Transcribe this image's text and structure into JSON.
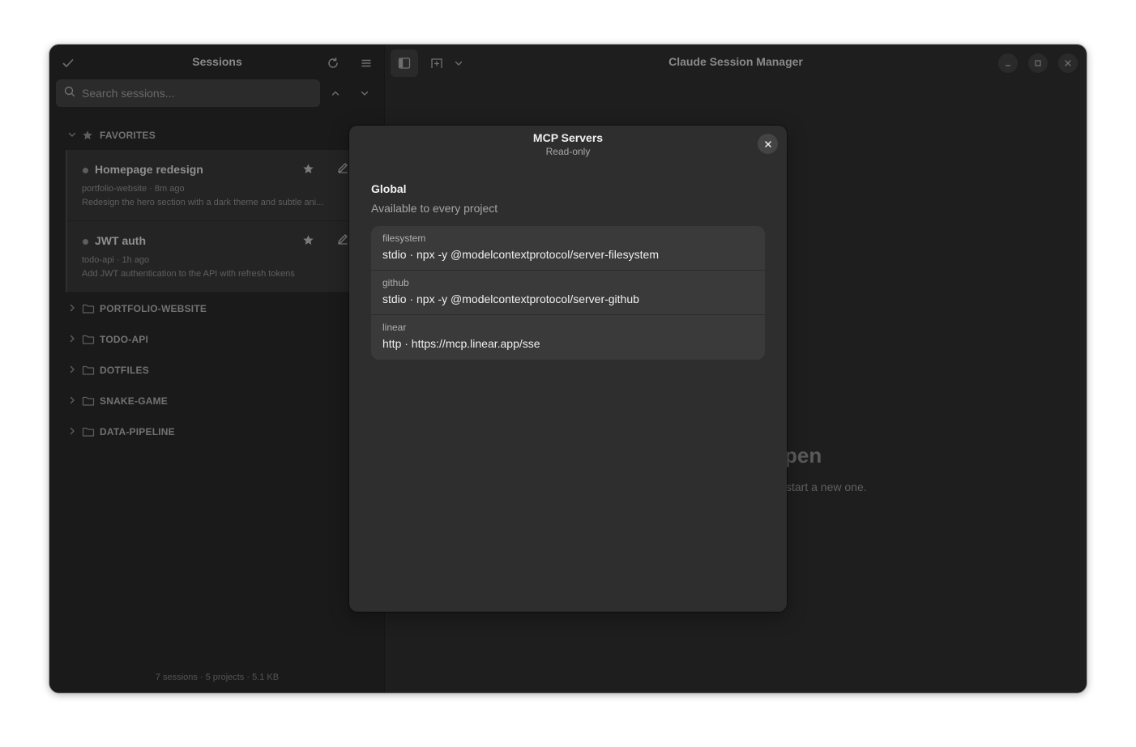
{
  "sidebar": {
    "title": "Sessions",
    "search_placeholder": "Search sessions...",
    "favorites_label": "FAVORITES",
    "favorites": [
      {
        "name": "Homepage redesign",
        "meta": "portfolio-website · 8m ago",
        "description": "Redesign the hero section with a dark theme and subtle ani..."
      },
      {
        "name": "JWT auth",
        "meta": "todo-api · 1h ago",
        "description": "Add JWT authentication to the API with refresh tokens"
      }
    ],
    "projects": [
      "PORTFOLIO-WEBSITE",
      "TODO-API",
      "DOTFILES",
      "SNAKE-GAME",
      "DATA-PIPELINE"
    ],
    "footer": "7 sessions · 5 projects · 5.1 KB"
  },
  "header": {
    "title": "Claude Session Manager"
  },
  "background": {
    "heading_fragment": "pen",
    "subtext_fragment": "start a new one."
  },
  "dialog": {
    "title": "MCP Servers",
    "subtitle": "Read-only",
    "section_title": "Global",
    "section_subtitle": "Available to every project",
    "servers": [
      {
        "name": "filesystem",
        "detail": "stdio · npx -y @modelcontextprotocol/server-filesystem"
      },
      {
        "name": "github",
        "detail": "stdio · npx -y @modelcontextprotocol/server-github"
      },
      {
        "name": "linear",
        "detail": "http · https://mcp.linear.app/sse"
      }
    ]
  },
  "icons": {
    "check": "check-icon",
    "refresh": "refresh-icon",
    "menu": "hamburger-menu-icon",
    "search": "search-icon",
    "chevron_up": "chevron-up-icon",
    "chevron_down": "chevron-down-icon",
    "star": "star-icon",
    "pencil": "pencil-icon",
    "folder": "folder-icon",
    "sidebar_toggle": "sidebar-toggle-icon",
    "new_tab": "new-tab-icon",
    "minimize": "minimize-icon",
    "maximize": "maximize-icon",
    "close": "close-icon"
  }
}
